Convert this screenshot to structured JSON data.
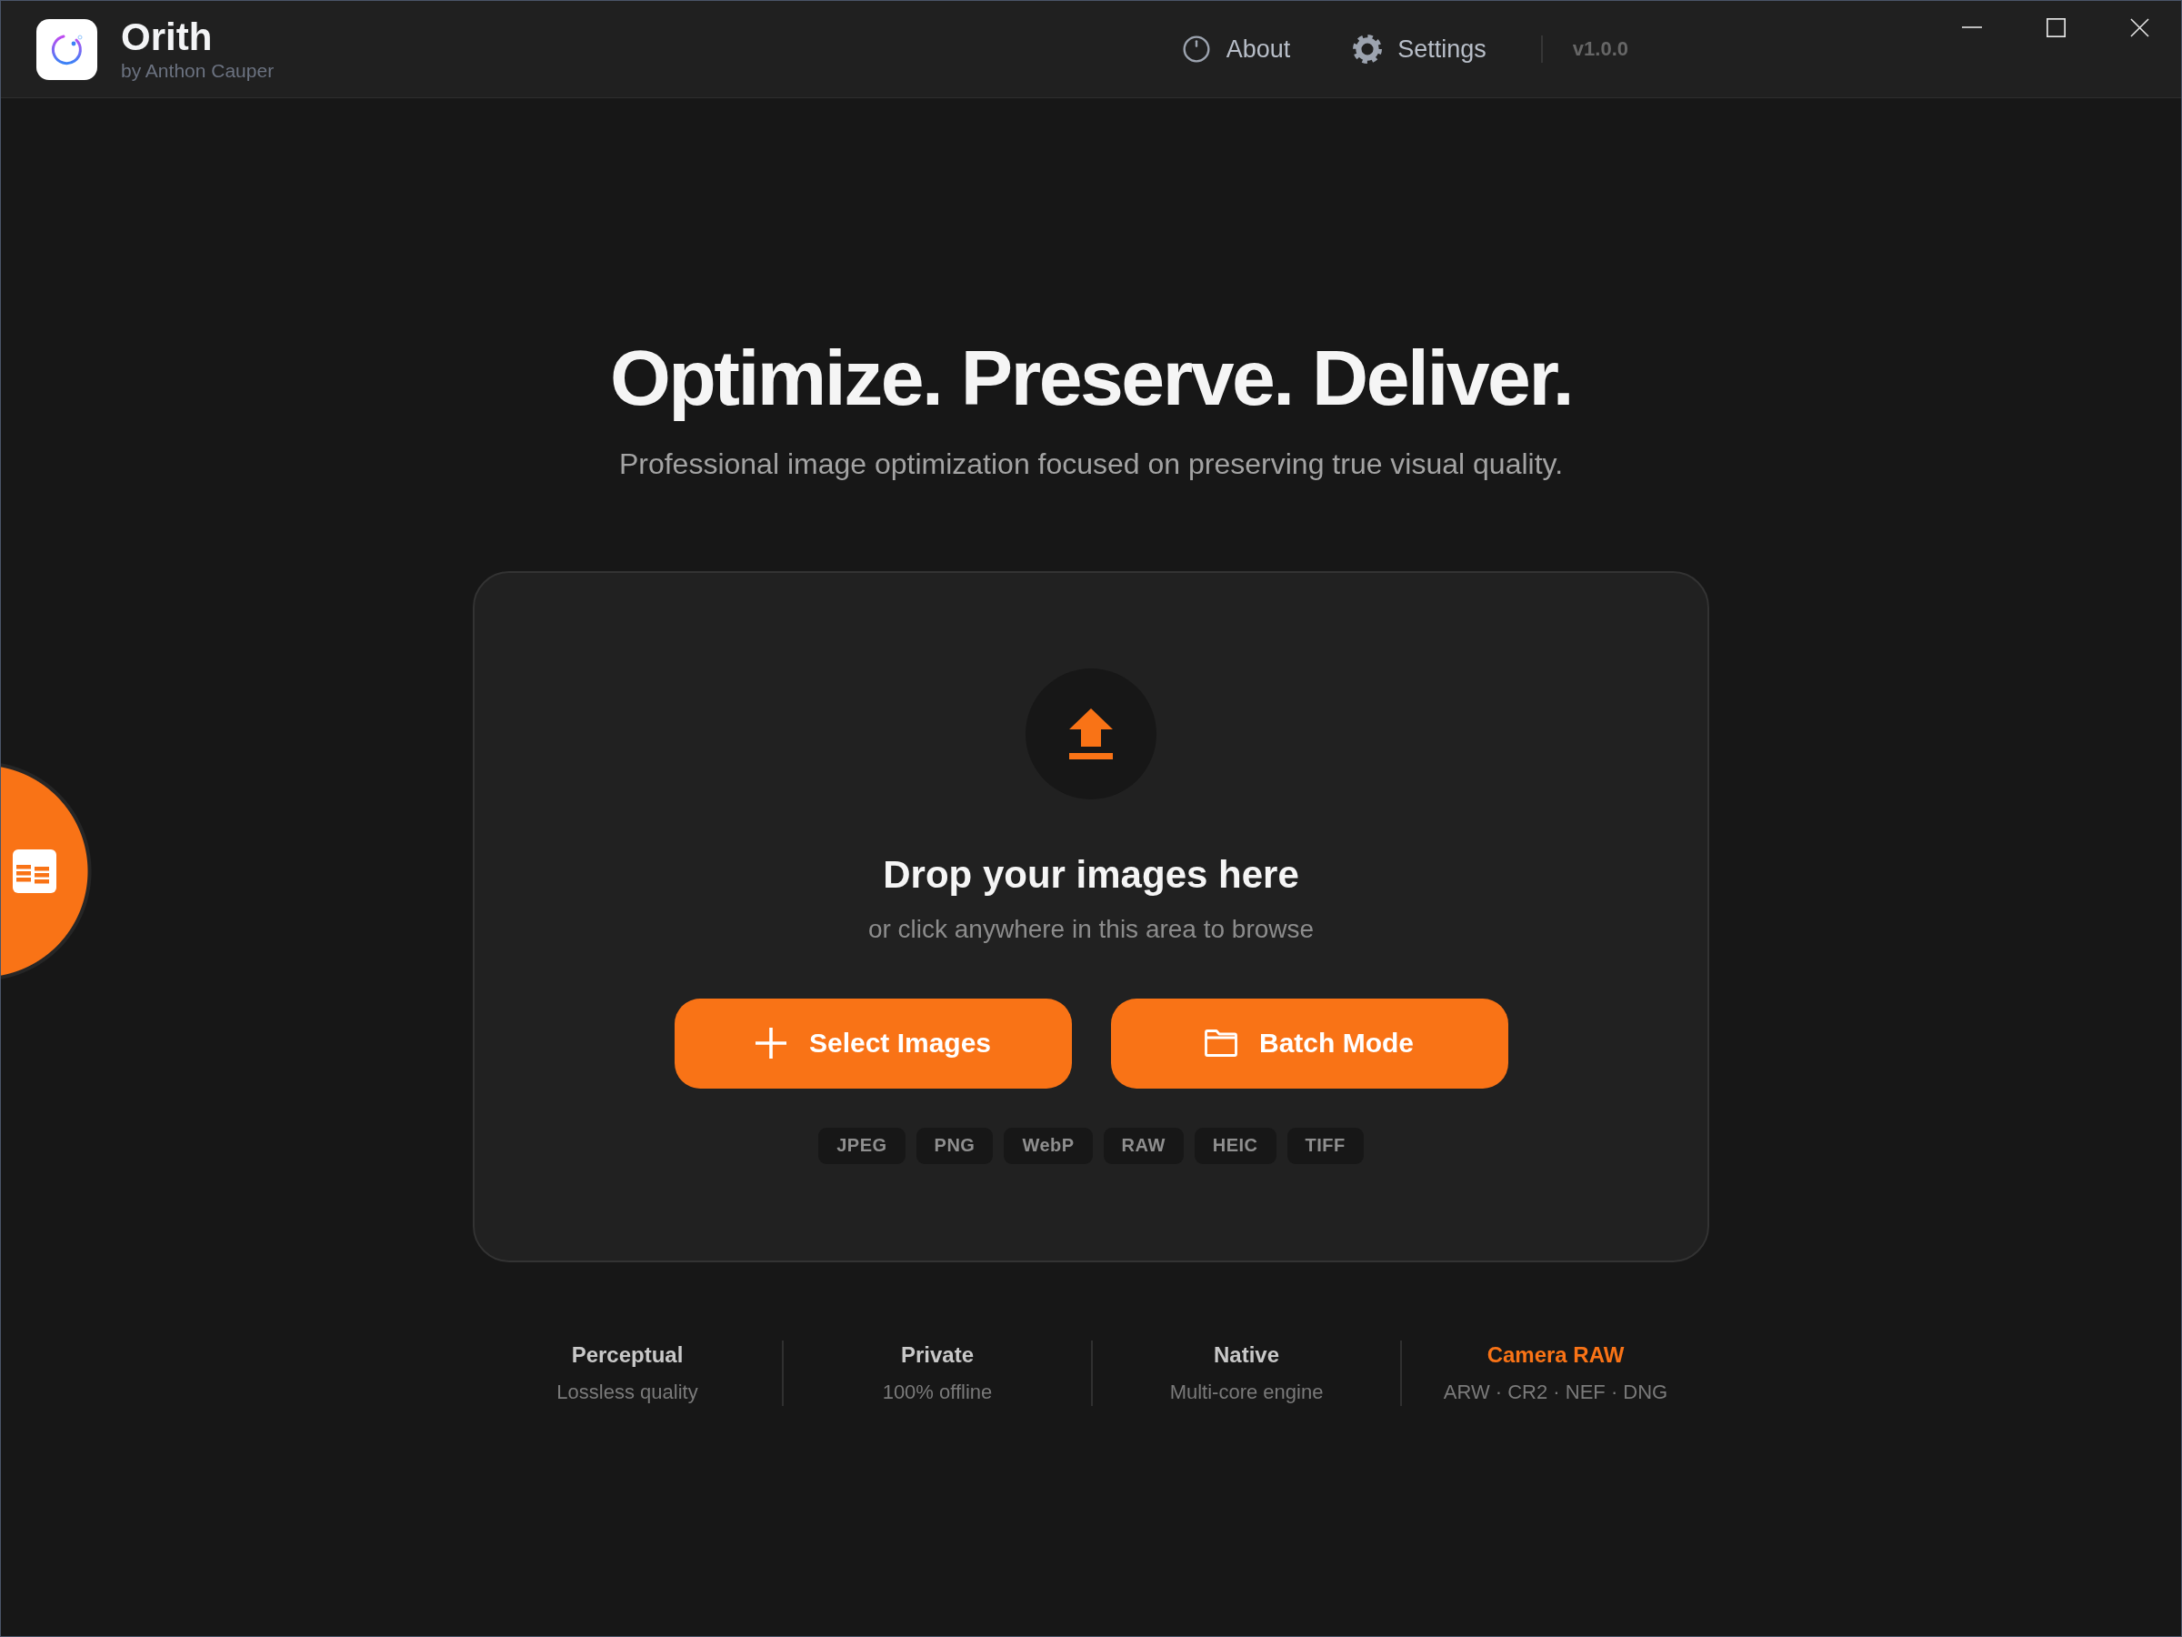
{
  "app": {
    "name": "Orith",
    "author": "by Anthon Cauper"
  },
  "nav": [
    {
      "kind": "about",
      "label": "About"
    },
    {
      "kind": "settings",
      "label": "Settings"
    }
  ],
  "version": "v1.0.0",
  "hero": {
    "title": "Optimize. Preserve. Deliver.",
    "subtitle": "Professional image optimization focused on preserving true visual quality."
  },
  "drop_zone": {
    "title": "Drop your images here",
    "hint": "or click anywhere in this area to browse",
    "buttons": [
      {
        "kind": "add",
        "label": "Select Images"
      },
      {
        "kind": "folder",
        "label": "Batch Mode"
      }
    ],
    "formats": [
      "JPEG",
      "PNG",
      "WebP",
      "RAW",
      "HEIC",
      "TIFF"
    ]
  },
  "features": [
    {
      "title": "Perceptual",
      "detail": "Lossless quality",
      "highlighted": false
    },
    {
      "title": "Private",
      "detail": "100% offline",
      "highlighted": false
    },
    {
      "title": "Native",
      "detail": "Multi-core engine",
      "highlighted": false
    },
    {
      "title": "Camera RAW",
      "detail": "ARW · CR2 · NEF · DNG",
      "highlighted": true
    }
  ]
}
